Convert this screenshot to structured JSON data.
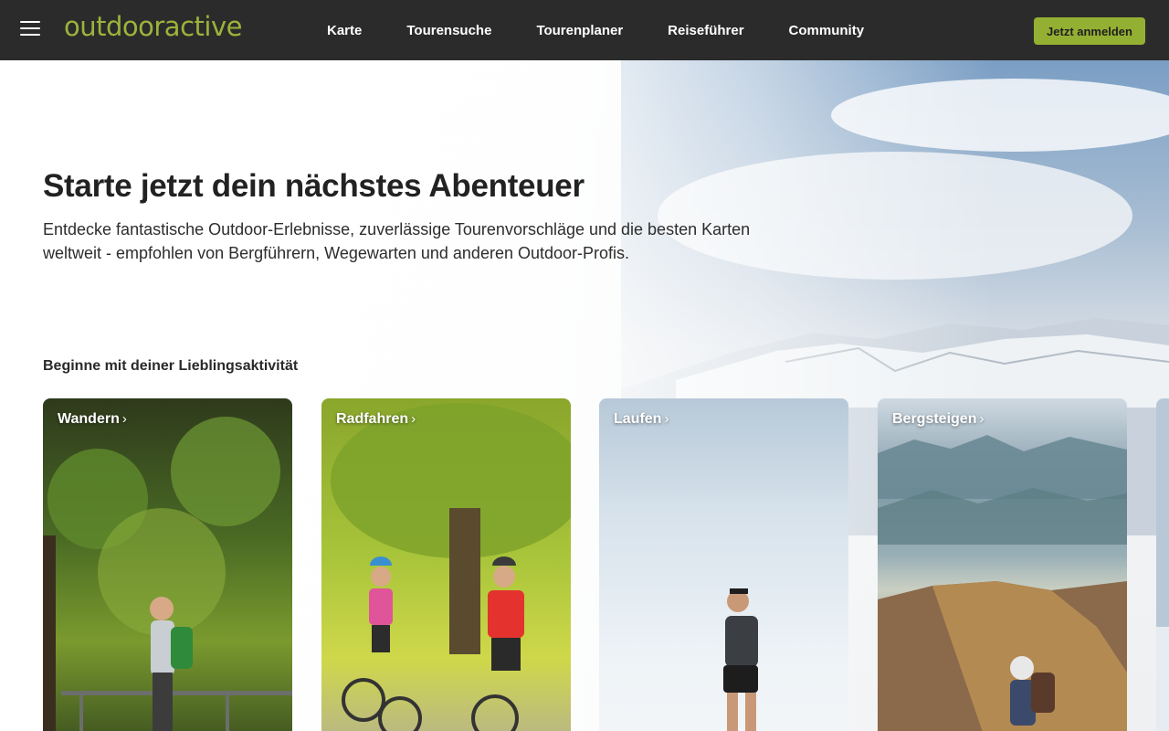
{
  "header": {
    "logo": "outdooractive",
    "nav": [
      "Karte",
      "Tourensuche",
      "Tourenplaner",
      "Reiseführer",
      "Community"
    ],
    "login_label": "Jetzt anmelden"
  },
  "hero": {
    "title": "Starte jetzt dein nächstes Abenteuer",
    "text": "Entdecke fantastische Outdoor-Erlebnisse, zuverlässige Tourenvorschläge und die besten Karten weltweit - empfohlen von Bergführern, Wegewarten und anderen Outdoor-Profis."
  },
  "activities": {
    "label": "Beginne mit deiner Lieblingsaktivität",
    "items": [
      {
        "name": "Wandern",
        "chevron": "›"
      },
      {
        "name": "Radfahren",
        "chevron": "›"
      },
      {
        "name": "Laufen",
        "chevron": "›"
      },
      {
        "name": "Bergsteigen",
        "chevron": "›"
      }
    ]
  },
  "colors": {
    "header_bg": "#2b2b2b",
    "brand_green": "#9cb33b",
    "button_green": "#94b033"
  }
}
